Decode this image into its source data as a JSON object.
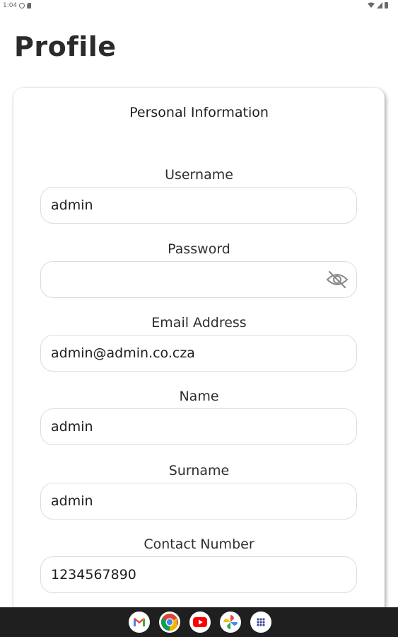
{
  "status_bar": {
    "time": "1:04"
  },
  "page": {
    "title": "Profile"
  },
  "card": {
    "title": "Personal Information",
    "fields": [
      {
        "label": "Username",
        "value": "admin"
      },
      {
        "label": "Password",
        "value": ""
      },
      {
        "label": "Email Address",
        "value": "admin@admin.co.cza"
      },
      {
        "label": "Name",
        "value": "admin"
      },
      {
        "label": "Surname",
        "value": "admin"
      },
      {
        "label": "Contact Number",
        "value": "1234567890"
      }
    ],
    "password_toggle_icon": "eye-off-icon"
  },
  "taskbar": {
    "apps": [
      "gmail-icon",
      "chrome-icon",
      "youtube-icon",
      "photos-icon",
      "app-drawer-icon"
    ]
  },
  "colors": {
    "title": "#2b2b2b",
    "field_border": "#dcdcdc",
    "taskbar": "#1f1f1f"
  }
}
